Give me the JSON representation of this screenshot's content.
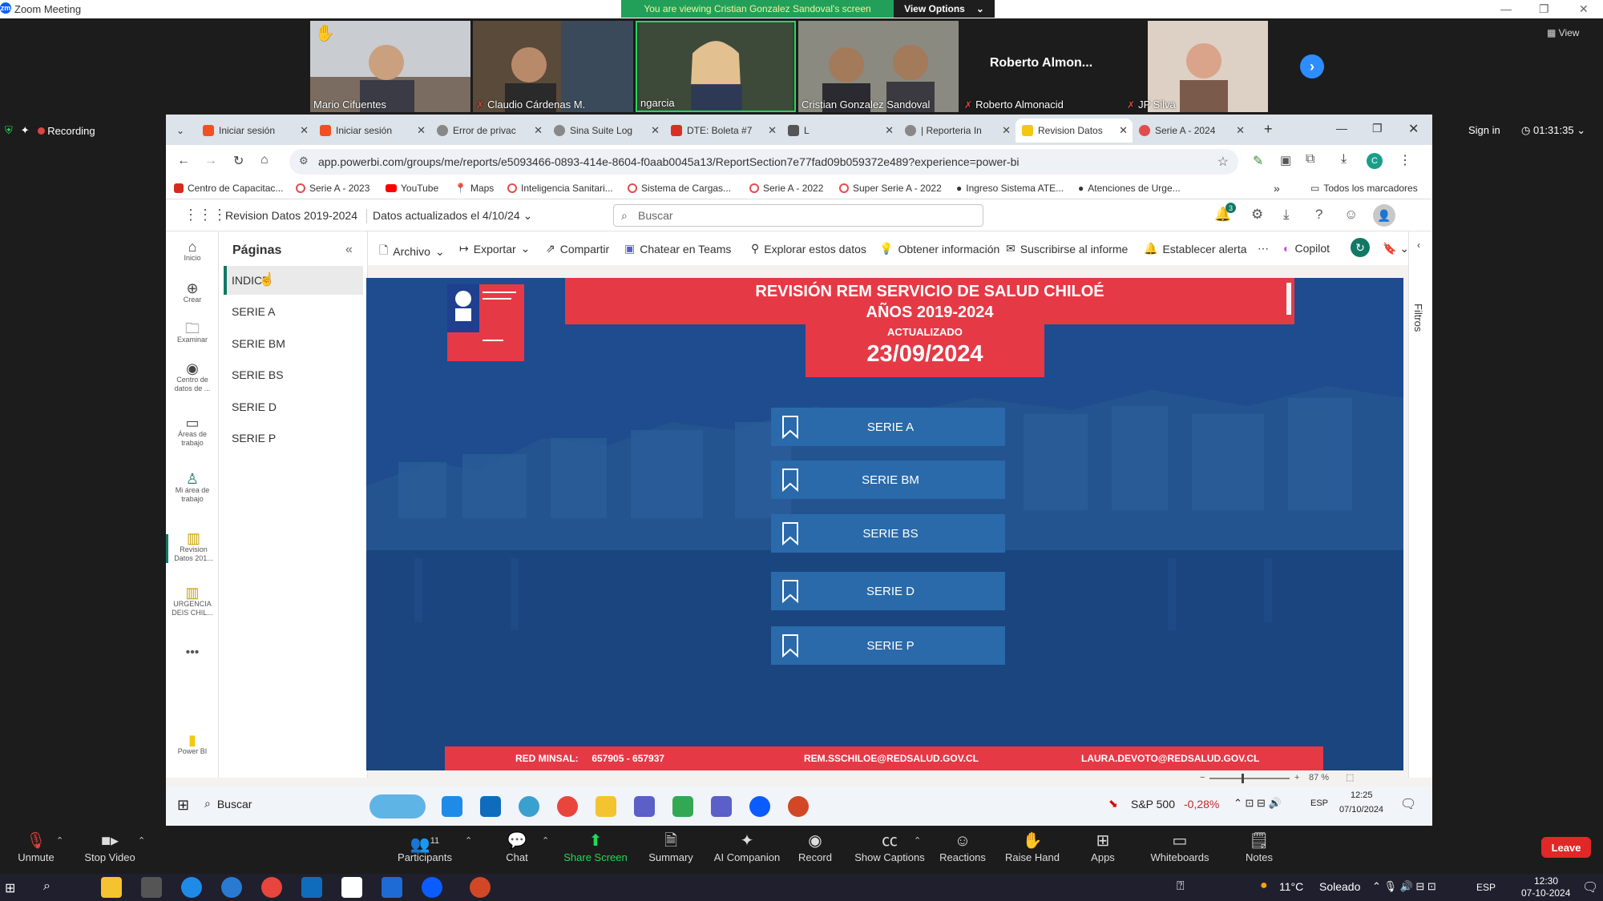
{
  "window": {
    "title": "Zoom Meeting"
  },
  "sharing": {
    "message": "You are viewing Cristian Gonzalez Sandoval's screen",
    "view_options": "View Options"
  },
  "participants_strip": [
    {
      "name": "Mario Cifuentes",
      "muted": false
    },
    {
      "name": "Claudio Cárdenas M.",
      "muted": true
    },
    {
      "name": "ngarcia",
      "muted": false
    },
    {
      "name": "Cristian Gonzalez Sandoval",
      "muted": false
    },
    {
      "name": "Roberto Almonacid",
      "display": "Roberto Almon...",
      "muted": true,
      "video": false
    },
    {
      "name": "JP Silva",
      "muted": true
    }
  ],
  "view_label": "View",
  "recording_label": "Recording",
  "sign_in": "Sign in",
  "timer": "01:31:35",
  "browser": {
    "tabs": [
      {
        "label": "Iniciar sesión",
        "color": "#f25022"
      },
      {
        "label": "Iniciar sesión",
        "color": "#f25022"
      },
      {
        "label": "Error de privac",
        "color": "#555"
      },
      {
        "label": "Sina Suite Log",
        "color": "#555"
      },
      {
        "label": "DTE: Boleta #7",
        "color": "#d93025"
      },
      {
        "label": "L",
        "color": "#555"
      },
      {
        "label": "| Reporteria In",
        "color": "#555"
      },
      {
        "label": "Revision Datos",
        "color": "#f2c811",
        "active": true
      },
      {
        "label": "Serie A - 2024",
        "color": "#e34c4c"
      }
    ],
    "url": "app.powerbi.com/groups/me/reports/e5093466-0893-414e-8604-f0aab0045a13/ReportSection7e77fad09b059372e489?experience=power-bi",
    "bookmarks": [
      "Centro de Capacitac...",
      "Serie A - 2023",
      "YouTube",
      "Maps",
      "Inteligencia Sanitari...",
      "Sistema de Cargas...",
      "Serie A - 2022",
      "Super Serie A - 2022",
      "Ingreso Sistema ATE...",
      "Atenciones de Urge..."
    ],
    "all_bookmarks": "Todos los marcadores"
  },
  "pbi": {
    "report_title": "Revision Datos 2019-2024",
    "updated": "Datos actualizados el 4/10/24",
    "search_placeholder": "Buscar",
    "notif_count": "3",
    "rail": [
      "Inicio",
      "Crear",
      "Examinar",
      "Centro de datos de ...",
      "Áreas de trabajo",
      "Mi área de trabajo",
      "Revision Datos 201...",
      "URGENCIA DEIS CHIL...",
      "Power BI"
    ],
    "pages_header": "Páginas",
    "pages": [
      "INDICE",
      "SERIE A",
      "SERIE BM",
      "SERIE BS",
      "SERIE D",
      "SERIE P"
    ],
    "toolbar": [
      "Archivo",
      "Exportar",
      "Compartir",
      "Chatear en Teams",
      "Explorar estos datos",
      "Obtener información",
      "Suscribirse al informe",
      "Establecer alerta",
      "Copilot"
    ],
    "filters_label": "Filtros",
    "zoom": "87 %"
  },
  "report": {
    "title_line1": "REVISIÓN REM SERVICIO DE SALUD CHILOÉ",
    "title_line2": "AÑOS 2019-2024",
    "updated_label": "ACTUALIZADO",
    "updated_date": "23/09/2024",
    "buttons": [
      "SERIE A",
      "SERIE BM",
      "SERIE BS",
      "SERIE D",
      "SERIE P"
    ],
    "footer": {
      "phones": "RED MINSAL:     657905 - 657937",
      "email1": "REM.SSCHILOE@REDSALUD.GOV.CL",
      "email2": "LAURA.DEVOTO@REDSALUD.GOV.CL"
    },
    "accent": "#e63946",
    "bg": "#1e4c8f"
  },
  "inner_taskbar": {
    "search": "Buscar",
    "stock": "S&P 500",
    "stock_change": "-0,28%",
    "lang": "ESP",
    "time": "12:25",
    "date": "07/10/2024"
  },
  "zoom_controls": {
    "items": [
      "Unmute",
      "Stop Video",
      "Participants",
      "Chat",
      "Share Screen",
      "Summary",
      "AI Companion",
      "Record",
      "Show Captions",
      "Reactions",
      "Raise Hand",
      "Apps",
      "Whiteboards",
      "Notes"
    ],
    "participants_count": "11",
    "leave": "Leave"
  },
  "win_taskbar": {
    "temp": "11°C",
    "weather": "Soleado",
    "lang": "ESP",
    "time": "12:30",
    "date": "07-10-2024"
  }
}
